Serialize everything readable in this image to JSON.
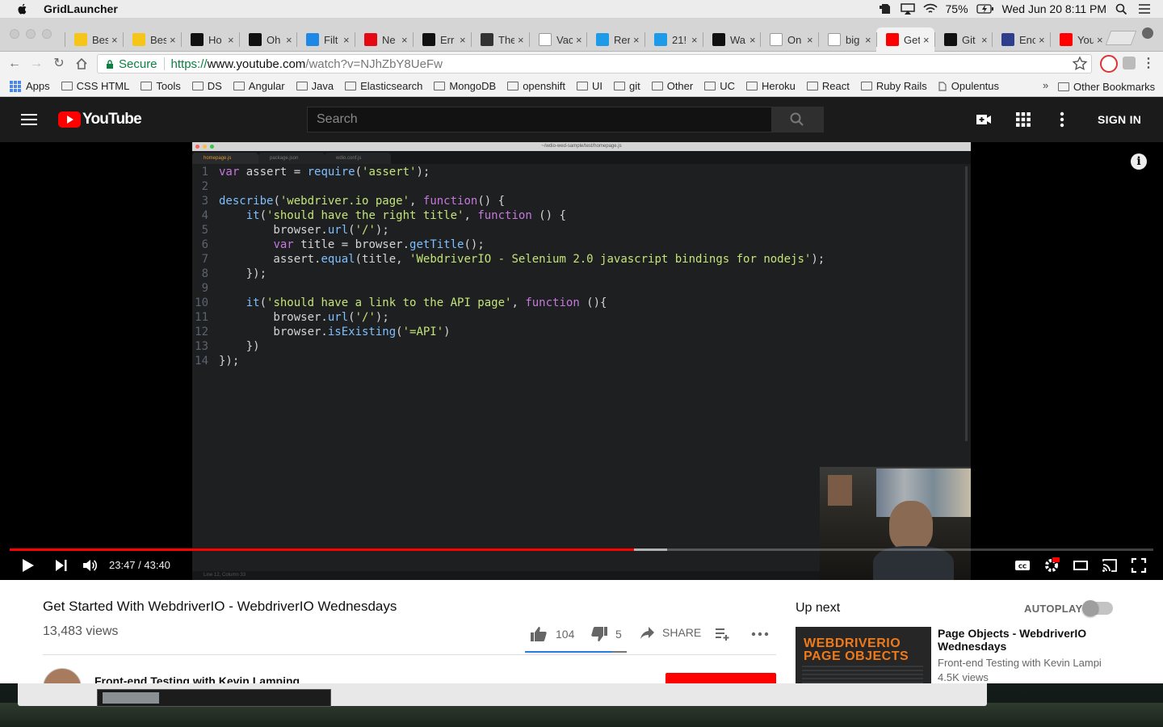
{
  "menubar": {
    "app_name": "GridLauncher",
    "battery": "75%",
    "datetime": "Wed Jun 20  8:11 PM"
  },
  "tabs": [
    {
      "label": "Bes",
      "favicon": "imdb-icon",
      "color": "#f5c518"
    },
    {
      "label": "Bes",
      "favicon": "imdb-icon",
      "color": "#f5c518"
    },
    {
      "label": "Ho",
      "favicon": "hk-icon",
      "color": "#111"
    },
    {
      "label": "Oh",
      "favicon": "netflix-icon",
      "color": "#111"
    },
    {
      "label": "Filt",
      "favicon": "filter-icon",
      "color": "#1e88e5"
    },
    {
      "label": "Ne",
      "favicon": "netflix-icon",
      "color": "#e50914"
    },
    {
      "label": "Err",
      "favicon": "ir-icon",
      "color": "#111"
    },
    {
      "label": "The",
      "favicon": "tripadvisor-icon",
      "color": "#333"
    },
    {
      "label": "Vac",
      "favicon": "page-icon",
      "color": "#fff"
    },
    {
      "label": "Rer",
      "favicon": "e-icon",
      "color": "#1e9be8"
    },
    {
      "label": "21!",
      "favicon": "e-icon",
      "color": "#1e9be8"
    },
    {
      "label": "Wa",
      "favicon": "t-icon",
      "color": "#111"
    },
    {
      "label": "On",
      "favicon": "u-icon",
      "color": "#fff"
    },
    {
      "label": "big",
      "favicon": "google-icon",
      "color": "#fff"
    },
    {
      "label": "Get",
      "favicon": "youtube-icon",
      "color": "#ff0000"
    },
    {
      "label": "Git",
      "favicon": "github-icon",
      "color": "#111"
    },
    {
      "label": "Enc",
      "favicon": "bookmark-icon",
      "color": "#2c3e8c"
    },
    {
      "label": "You",
      "favicon": "youtube-icon",
      "color": "#ff0000"
    }
  ],
  "omnibox": {
    "secure_label": "Secure",
    "scheme": "https://",
    "host": "www.youtube.com",
    "path": "/watch?v=NJhZbY8UeFw"
  },
  "bookmarks": {
    "apps_label": "Apps",
    "items": [
      "CSS HTML",
      "Tools",
      "DS",
      "Angular",
      "Java",
      "Elasticsearch",
      "MongoDB",
      "openshift",
      "UI",
      "git",
      "Other",
      "UC",
      "Heroku",
      "React",
      "Ruby Rails"
    ],
    "file_item": "Opulentus",
    "overflow": "»",
    "other": "Other Bookmarks"
  },
  "youtube": {
    "logo_text": "YouTube",
    "search_placeholder": "Search",
    "sign_in": "SIGN IN"
  },
  "editor": {
    "window_title": "~/wdio-wed-sample/test/homepage.js",
    "tabs": [
      "homepage.js",
      "package.json",
      "wdio.conf.js"
    ],
    "status": "Line 12, Column 33",
    "code": [
      {
        "n": "1",
        "t": "var assert = require('assert');"
      },
      {
        "n": "2",
        "t": ""
      },
      {
        "n": "3",
        "t": "describe('webdriver.io page', function() {"
      },
      {
        "n": "4",
        "t": "    it('should have the right title', function () {"
      },
      {
        "n": "5",
        "t": "        browser.url('/');"
      },
      {
        "n": "6",
        "t": "        var title = browser.getTitle();"
      },
      {
        "n": "7",
        "t": "        assert.equal(title, 'WebdriverIO - Selenium 2.0 javascript bindings for nodejs');"
      },
      {
        "n": "8",
        "t": "    });"
      },
      {
        "n": "9",
        "t": ""
      },
      {
        "n": "10",
        "t": "    it('should have a link to the API page', function (){"
      },
      {
        "n": "11",
        "t": "        browser.url('/');"
      },
      {
        "n": "12",
        "t": "        browser.isExisting('=API')"
      },
      {
        "n": "13",
        "t": "    })"
      },
      {
        "n": "14",
        "t": "});"
      }
    ]
  },
  "player": {
    "time": "23:47 / 43:40",
    "played_fraction": 0.546,
    "buffered_fraction": 0.575,
    "accent": "#ff0000"
  },
  "video": {
    "title": "Get Started With WebdriverIO - WebdriverIO Wednesdays",
    "views": "13,483 views",
    "likes": "104",
    "dislikes": "5",
    "share": "SHARE",
    "channel": "Front-end Testing with Kevin Lamping"
  },
  "upnext": {
    "heading": "Up next",
    "autoplay": "AUTOPLAY",
    "thumb_line1": "WEBDRIVERIO",
    "thumb_line2": "PAGE OBJECTS",
    "title": "Page Objects - WebdriverIO Wednesdays",
    "channel": "Front-end Testing with Kevin Lampi",
    "views": "4.5K views"
  }
}
